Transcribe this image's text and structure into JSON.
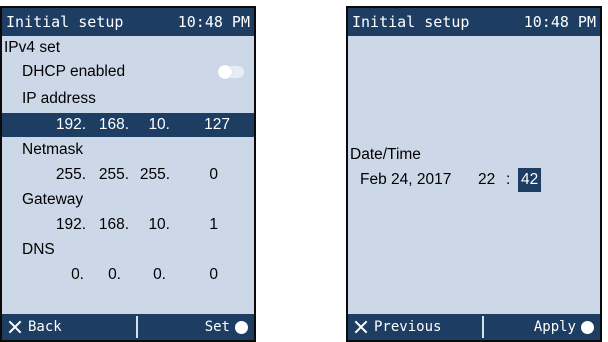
{
  "left_screen": {
    "title": "Initial setup",
    "time": "10:48 PM",
    "section_label": "IPv4 set",
    "dhcp": {
      "label": "DHCP enabled",
      "enabled": false
    },
    "ip_address": {
      "label": "IP address",
      "octets": [
        "192.",
        "168.",
        "10.",
        "127"
      ]
    },
    "netmask": {
      "label": "Netmask",
      "octets": [
        "255.",
        "255.",
        "255.",
        "0"
      ]
    },
    "gateway": {
      "label": "Gateway",
      "octets": [
        "192.",
        "168.",
        "10.",
        "1"
      ]
    },
    "dns": {
      "label": "DNS",
      "octets": [
        "0.",
        "0.",
        "0.",
        "0"
      ]
    },
    "footer": {
      "back_label": "Back",
      "set_label": "Set"
    }
  },
  "right_screen": {
    "title": "Initial setup",
    "time": "10:48 PM",
    "datetime_label": "Date/Time",
    "date": "Feb 24, 2017",
    "hour": "22",
    "separator": ":",
    "minute": "42",
    "footer": {
      "previous_label": "Previous",
      "apply_label": "Apply"
    }
  },
  "colors": {
    "bar": "#1d3d63",
    "content_bg": "#ccd8e7",
    "selection": "#1d3d63"
  }
}
